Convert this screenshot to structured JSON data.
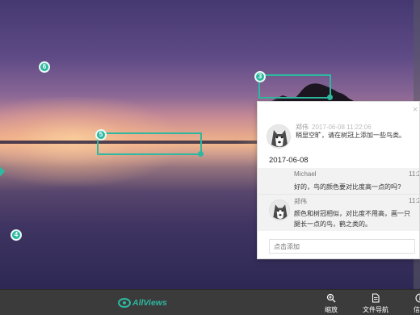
{
  "hotspots": {
    "h6": "6",
    "h3": "3",
    "h5": "5",
    "h4": "4"
  },
  "panel": {
    "close": "×",
    "messages": [
      {
        "name": "郑伟",
        "time": "2017-06-08 11:22:06",
        "text": "稍显空旷，请在树冠上添加一些鸟类。"
      },
      {
        "name": "Michael",
        "time": "11:2",
        "text": "好的，鸟的颜色要对比度高一点的吗?"
      },
      {
        "name": "郑伟",
        "time": "11:2",
        "text": "颜色和树冠相似，对比度不用高，画一只腿长一点的鸟，鹤之类的。"
      }
    ],
    "date_separator": "2017-06-08",
    "comment_placeholder": "点击添加"
  },
  "bottombar": {
    "logo": "AllViews",
    "tools": {
      "zoom": "缩放",
      "files": "文件导航",
      "info": "信息"
    }
  },
  "colors": {
    "accent": "#2eb8a0",
    "bar": "#3b3b3b"
  },
  "icons": [
    "zoom-icon",
    "file-icon",
    "info-icon",
    "close-icon",
    "avatar-dog",
    "allviews-logo-icon"
  ]
}
